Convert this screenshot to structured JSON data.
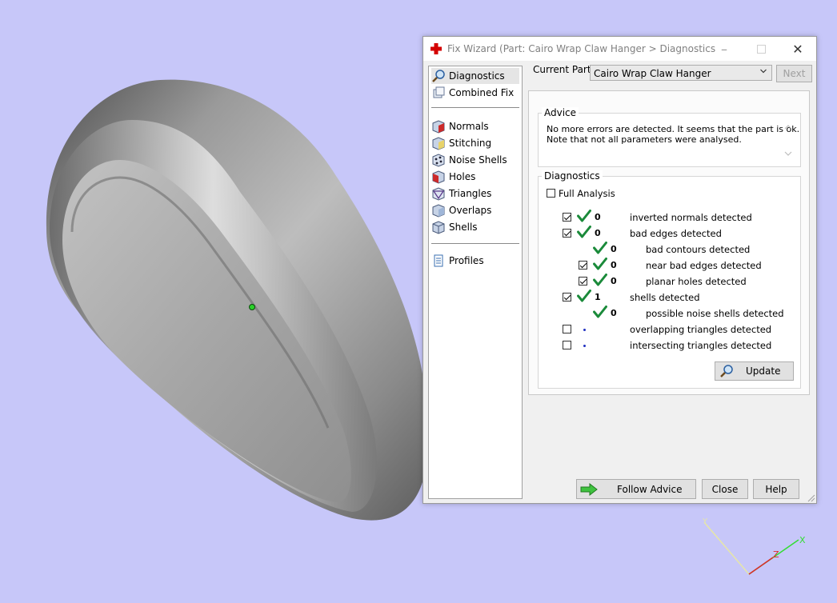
{
  "window": {
    "title": "Fix Wizard (Part: Cairo Wrap Claw Hanger > Diagnostics",
    "minimize_icon": "minimize-icon",
    "maximize_icon": "maximize-icon",
    "close_icon": "close-icon"
  },
  "sidebar": {
    "items": [
      {
        "label": "Diagnostics",
        "icon": "magnifier-icon"
      },
      {
        "label": "Combined Fix",
        "icon": "cubes-icon"
      },
      {
        "label": "Normals",
        "icon": "cube-red-icon"
      },
      {
        "label": "Stitching",
        "icon": "cube-yellow-icon"
      },
      {
        "label": "Noise Shells",
        "icon": "cube-dots-icon"
      },
      {
        "label": "Holes",
        "icon": "cube-hole-icon"
      },
      {
        "label": "Triangles",
        "icon": "triangle-icon"
      },
      {
        "label": "Overlaps",
        "icon": "cube-overlap-icon"
      },
      {
        "label": "Shells",
        "icon": "cube-shell-icon"
      },
      {
        "label": "Profiles",
        "icon": "document-icon"
      }
    ]
  },
  "current_part": {
    "label": "Current Part:",
    "value": "Cairo Wrap Claw Hanger",
    "next_label": "Next"
  },
  "advice": {
    "title": "Advice",
    "text_line1": "No more errors are detected. It seems that the part is ok.",
    "text_line2": "Note that not all parameters were analysed."
  },
  "diagnostics": {
    "title": "Diagnostics",
    "full_analysis_label": "Full Analysis",
    "rows": [
      {
        "value": "0",
        "label": "inverted normals detected"
      },
      {
        "value": "0",
        "label": "bad edges detected"
      },
      {
        "value": "0",
        "label": "bad contours detected"
      },
      {
        "value": "0",
        "label": "near bad edges detected"
      },
      {
        "value": "0",
        "label": "planar holes detected"
      },
      {
        "value": "1",
        "label": "shells detected"
      },
      {
        "value": "0",
        "label": "possible noise shells detected"
      },
      {
        "value": "",
        "label": "overlapping triangles detected"
      },
      {
        "value": "",
        "label": "intersecting triangles detected"
      }
    ],
    "update_label": "Update"
  },
  "footer": {
    "follow_advice_label": "Follow Advice",
    "close_label": "Close",
    "help_label": "Help"
  },
  "axes": {
    "x_label": "X",
    "y_label": "Y",
    "z_label": "Z"
  },
  "colors": {
    "background": "#c7c7f9",
    "tick": "#1a8a3a",
    "accent": "#d40000"
  }
}
